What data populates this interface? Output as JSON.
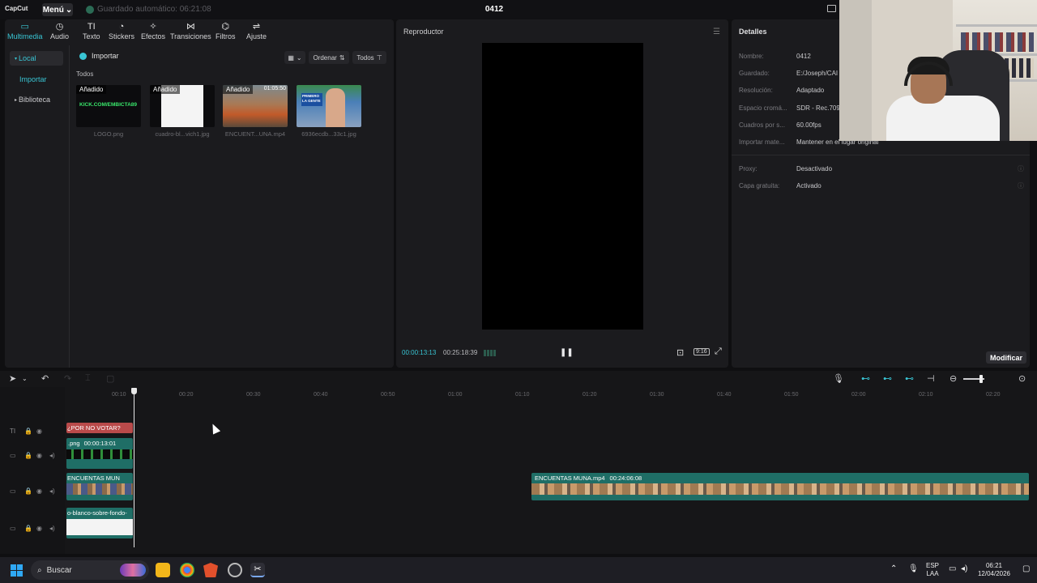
{
  "app": {
    "logo": "CapCut",
    "menu_label": "Menú",
    "autosave": "Guardado automático: 06:21:08",
    "project_title": "0412"
  },
  "media": {
    "tabs": [
      {
        "label": "Multimedia",
        "icon": "media-icon"
      },
      {
        "label": "Audio",
        "icon": "audio-icon"
      },
      {
        "label": "Texto",
        "icon": "text-icon"
      },
      {
        "label": "Stickers",
        "icon": "sticker-icon"
      },
      {
        "label": "Efectos",
        "icon": "effects-icon"
      },
      {
        "label": "Transiciones",
        "icon": "transitions-icon"
      },
      {
        "label": "Filtros",
        "icon": "filters-icon"
      },
      {
        "label": "Ajuste",
        "icon": "adjust-icon"
      }
    ],
    "sidebar": [
      "Local",
      "Importar",
      "Biblioteca"
    ],
    "import_label": "Importar",
    "sort_label": "Ordenar",
    "filter_label": "Todos",
    "all_label": "Todos",
    "items": [
      {
        "name": "LOGO.png",
        "badge": "Añadido",
        "thumb_text": "KICK.COM/EMBICTA89"
      },
      {
        "name": "cuadro-bl...vich1.jpg",
        "badge": "Añadido"
      },
      {
        "name": "ENCUENT...UNA.mp4",
        "badge": "Añadido",
        "duration": "01:05:50"
      },
      {
        "name": "6936ecdb...33c1.jpg",
        "thumb_text": "PRIMERO LA GENTE"
      }
    ]
  },
  "player": {
    "title": "Reproductor",
    "current_time": "00:00:13:13",
    "total_time": "00:25:18:39",
    "ratio_label": "9:16"
  },
  "details": {
    "title": "Detalles",
    "rows": [
      {
        "label": "Nombre:",
        "value": "0412"
      },
      {
        "label": "Guardado:",
        "value": "E:/Joseph/CAI"
      },
      {
        "label": "Resolución:",
        "value": "Adaptado"
      },
      {
        "label": "Espacio cromá...",
        "value": "SDR - Rec.709"
      },
      {
        "label": "Cuadros por s...",
        "value": "60.00fps"
      },
      {
        "label": "Importar mate...",
        "value": "Mantener en el lugar original"
      }
    ],
    "rows2": [
      {
        "label": "Proxy:",
        "value": "Desactivado"
      },
      {
        "label": "Capa gratuita:",
        "value": "Activado"
      }
    ],
    "modify_label": "Modificar"
  },
  "timeline": {
    "ruler": [
      "00:10",
      "00:20",
      "00:30",
      "00:40",
      "00:50",
      "01:00",
      "01:10",
      "01:20",
      "01:30",
      "01:40",
      "01:50",
      "02:00",
      "02:10",
      "02:20"
    ],
    "clips": {
      "text_clip": "¿POR NO VOTAR?",
      "logo_clip_name": ".png",
      "logo_clip_duration": "00:00:13:01",
      "main_clip_left": "ENCUENTAS MUN",
      "main_clip_right_name": "ENCUENTAS MUNA.mp4",
      "main_clip_right_duration": "00:24:06:08",
      "bg_clip": "o-blanco-sobre-fondo-"
    }
  },
  "taskbar": {
    "search_placeholder": "Buscar",
    "lang_top": "ESP",
    "lang_bottom": "LAA",
    "time": "06:21",
    "date": "12/04/2026"
  }
}
